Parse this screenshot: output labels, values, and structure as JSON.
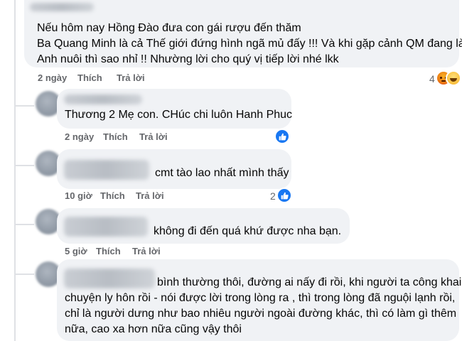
{
  "comments": [
    {
      "lines": [
        "Nếu hôm nay Hồng Đào đưa con gái rượu đến thăm",
        "Ba Quang Minh là cả Thế giới đứng hình ngã mủ đấy !!! Và khi gặp cảnh QM đang làm",
        "Anh nuôi thì sao nhỉ !! Nhường lời cho quý vị tiếp lời nhé lkk"
      ],
      "time": "2 ngày",
      "like": "Thích",
      "reply": "Trả lời",
      "reaction_count": "4",
      "reactions": [
        "angry",
        "haha"
      ]
    },
    {
      "lines": [
        "Thương 2 Mẹ con. CHúc chi luôn Hanh Phuc"
      ],
      "time": "2 ngày",
      "like": "Thích",
      "reply": "Trả lời",
      "reaction_count": "",
      "reactions": [
        "like"
      ]
    },
    {
      "lines": [
        "cmt tào lao nhất mình thấy"
      ],
      "time": "10 giờ",
      "like": "Thích",
      "reply": "Trả lời",
      "reaction_count": "2",
      "reactions": [
        "like"
      ]
    },
    {
      "lines": [
        "không đi đến quá khứ được nha bạn."
      ],
      "time": "5 giờ",
      "like": "Thích",
      "reply": "Trả lời",
      "reaction_count": "",
      "reactions": []
    },
    {
      "lines": [
        "bình thường thôi, đường ai nấy đi rồi, khi người ta công khai",
        "chuyện ly hôn rồi - nói được lời trong lòng ra , thì trong lòng đã nguội lạnh rồi,",
        "chỉ là người dưng như bao nhiêu người ngoài đường khác, thì có làm gì thêm",
        "nữa, cao xa hơn nữa cũng vậy thôi"
      ],
      "time": "",
      "like": "",
      "reply": "",
      "reaction_count": "",
      "reactions": []
    }
  ],
  "colors": {
    "bubble": "#f0f2f5",
    "meta": "#65676b",
    "like_blue": "#1877f2"
  }
}
